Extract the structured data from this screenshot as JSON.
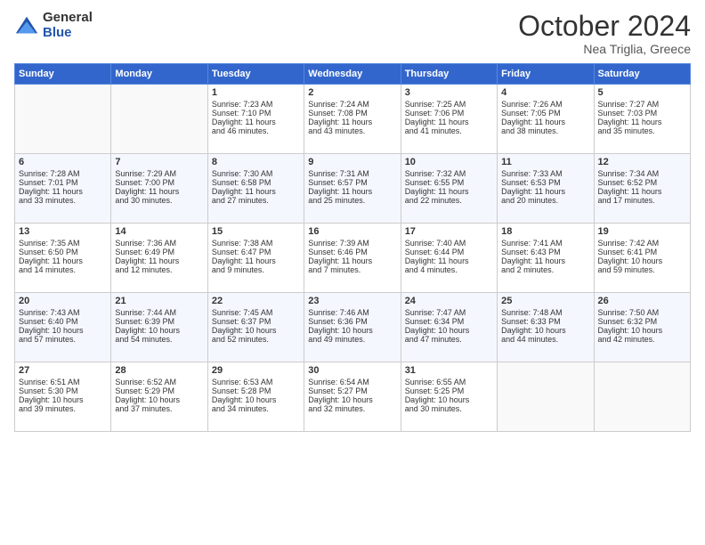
{
  "logo": {
    "general": "General",
    "blue": "Blue"
  },
  "header": {
    "title": "October 2024",
    "subtitle": "Nea Triglia, Greece"
  },
  "weekdays": [
    "Sunday",
    "Monday",
    "Tuesday",
    "Wednesday",
    "Thursday",
    "Friday",
    "Saturday"
  ],
  "weeks": [
    [
      {
        "day": "",
        "lines": []
      },
      {
        "day": "",
        "lines": []
      },
      {
        "day": "1",
        "lines": [
          "Sunrise: 7:23 AM",
          "Sunset: 7:10 PM",
          "Daylight: 11 hours",
          "and 46 minutes."
        ]
      },
      {
        "day": "2",
        "lines": [
          "Sunrise: 7:24 AM",
          "Sunset: 7:08 PM",
          "Daylight: 11 hours",
          "and 43 minutes."
        ]
      },
      {
        "day": "3",
        "lines": [
          "Sunrise: 7:25 AM",
          "Sunset: 7:06 PM",
          "Daylight: 11 hours",
          "and 41 minutes."
        ]
      },
      {
        "day": "4",
        "lines": [
          "Sunrise: 7:26 AM",
          "Sunset: 7:05 PM",
          "Daylight: 11 hours",
          "and 38 minutes."
        ]
      },
      {
        "day": "5",
        "lines": [
          "Sunrise: 7:27 AM",
          "Sunset: 7:03 PM",
          "Daylight: 11 hours",
          "and 35 minutes."
        ]
      }
    ],
    [
      {
        "day": "6",
        "lines": [
          "Sunrise: 7:28 AM",
          "Sunset: 7:01 PM",
          "Daylight: 11 hours",
          "and 33 minutes."
        ]
      },
      {
        "day": "7",
        "lines": [
          "Sunrise: 7:29 AM",
          "Sunset: 7:00 PM",
          "Daylight: 11 hours",
          "and 30 minutes."
        ]
      },
      {
        "day": "8",
        "lines": [
          "Sunrise: 7:30 AM",
          "Sunset: 6:58 PM",
          "Daylight: 11 hours",
          "and 27 minutes."
        ]
      },
      {
        "day": "9",
        "lines": [
          "Sunrise: 7:31 AM",
          "Sunset: 6:57 PM",
          "Daylight: 11 hours",
          "and 25 minutes."
        ]
      },
      {
        "day": "10",
        "lines": [
          "Sunrise: 7:32 AM",
          "Sunset: 6:55 PM",
          "Daylight: 11 hours",
          "and 22 minutes."
        ]
      },
      {
        "day": "11",
        "lines": [
          "Sunrise: 7:33 AM",
          "Sunset: 6:53 PM",
          "Daylight: 11 hours",
          "and 20 minutes."
        ]
      },
      {
        "day": "12",
        "lines": [
          "Sunrise: 7:34 AM",
          "Sunset: 6:52 PM",
          "Daylight: 11 hours",
          "and 17 minutes."
        ]
      }
    ],
    [
      {
        "day": "13",
        "lines": [
          "Sunrise: 7:35 AM",
          "Sunset: 6:50 PM",
          "Daylight: 11 hours",
          "and 14 minutes."
        ]
      },
      {
        "day": "14",
        "lines": [
          "Sunrise: 7:36 AM",
          "Sunset: 6:49 PM",
          "Daylight: 11 hours",
          "and 12 minutes."
        ]
      },
      {
        "day": "15",
        "lines": [
          "Sunrise: 7:38 AM",
          "Sunset: 6:47 PM",
          "Daylight: 11 hours",
          "and 9 minutes."
        ]
      },
      {
        "day": "16",
        "lines": [
          "Sunrise: 7:39 AM",
          "Sunset: 6:46 PM",
          "Daylight: 11 hours",
          "and 7 minutes."
        ]
      },
      {
        "day": "17",
        "lines": [
          "Sunrise: 7:40 AM",
          "Sunset: 6:44 PM",
          "Daylight: 11 hours",
          "and 4 minutes."
        ]
      },
      {
        "day": "18",
        "lines": [
          "Sunrise: 7:41 AM",
          "Sunset: 6:43 PM",
          "Daylight: 11 hours",
          "and 2 minutes."
        ]
      },
      {
        "day": "19",
        "lines": [
          "Sunrise: 7:42 AM",
          "Sunset: 6:41 PM",
          "Daylight: 10 hours",
          "and 59 minutes."
        ]
      }
    ],
    [
      {
        "day": "20",
        "lines": [
          "Sunrise: 7:43 AM",
          "Sunset: 6:40 PM",
          "Daylight: 10 hours",
          "and 57 minutes."
        ]
      },
      {
        "day": "21",
        "lines": [
          "Sunrise: 7:44 AM",
          "Sunset: 6:39 PM",
          "Daylight: 10 hours",
          "and 54 minutes."
        ]
      },
      {
        "day": "22",
        "lines": [
          "Sunrise: 7:45 AM",
          "Sunset: 6:37 PM",
          "Daylight: 10 hours",
          "and 52 minutes."
        ]
      },
      {
        "day": "23",
        "lines": [
          "Sunrise: 7:46 AM",
          "Sunset: 6:36 PM",
          "Daylight: 10 hours",
          "and 49 minutes."
        ]
      },
      {
        "day": "24",
        "lines": [
          "Sunrise: 7:47 AM",
          "Sunset: 6:34 PM",
          "Daylight: 10 hours",
          "and 47 minutes."
        ]
      },
      {
        "day": "25",
        "lines": [
          "Sunrise: 7:48 AM",
          "Sunset: 6:33 PM",
          "Daylight: 10 hours",
          "and 44 minutes."
        ]
      },
      {
        "day": "26",
        "lines": [
          "Sunrise: 7:50 AM",
          "Sunset: 6:32 PM",
          "Daylight: 10 hours",
          "and 42 minutes."
        ]
      }
    ],
    [
      {
        "day": "27",
        "lines": [
          "Sunrise: 6:51 AM",
          "Sunset: 5:30 PM",
          "Daylight: 10 hours",
          "and 39 minutes."
        ]
      },
      {
        "day": "28",
        "lines": [
          "Sunrise: 6:52 AM",
          "Sunset: 5:29 PM",
          "Daylight: 10 hours",
          "and 37 minutes."
        ]
      },
      {
        "day": "29",
        "lines": [
          "Sunrise: 6:53 AM",
          "Sunset: 5:28 PM",
          "Daylight: 10 hours",
          "and 34 minutes."
        ]
      },
      {
        "day": "30",
        "lines": [
          "Sunrise: 6:54 AM",
          "Sunset: 5:27 PM",
          "Daylight: 10 hours",
          "and 32 minutes."
        ]
      },
      {
        "day": "31",
        "lines": [
          "Sunrise: 6:55 AM",
          "Sunset: 5:25 PM",
          "Daylight: 10 hours",
          "and 30 minutes."
        ]
      },
      {
        "day": "",
        "lines": []
      },
      {
        "day": "",
        "lines": []
      }
    ]
  ]
}
